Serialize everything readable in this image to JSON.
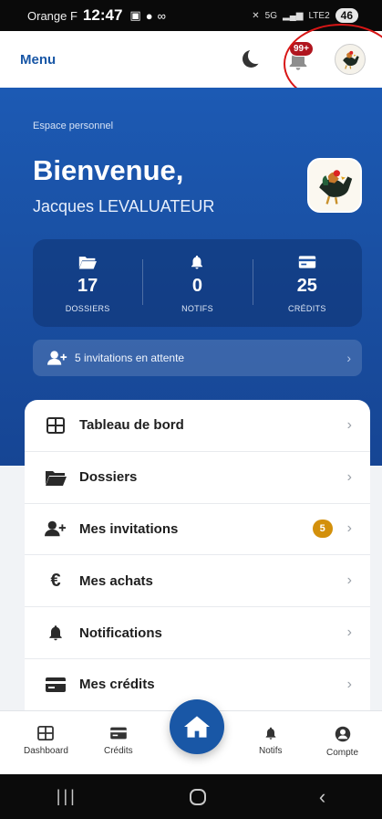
{
  "status_bar": {
    "carrier": "Orange F",
    "time": "12:47",
    "network": "5G",
    "lte": "LTE2",
    "battery": "46"
  },
  "appbar": {
    "menu_label": "Menu",
    "notif_badge": "99+"
  },
  "hero": {
    "space_label": "Espace personnel",
    "welcome": "Bienvenue,",
    "user_name": "Jacques LEVALUATEUR",
    "stats": [
      {
        "icon": "folder-icon",
        "value": "17",
        "label": "DOSSIERS"
      },
      {
        "icon": "bell-icon",
        "value": "0",
        "label": "NOTIFS"
      },
      {
        "icon": "credit-card-icon",
        "value": "25",
        "label": "CRÉDITS"
      }
    ],
    "invitations_text": "5 invitations en attente"
  },
  "menu": {
    "items": [
      {
        "icon": "grid-icon",
        "label": "Tableau de bord"
      },
      {
        "icon": "folder-icon",
        "label": "Dossiers"
      },
      {
        "icon": "user-plus-icon",
        "label": "Mes invitations",
        "badge": "5"
      },
      {
        "icon": "euro-icon",
        "label": "Mes achats"
      },
      {
        "icon": "bell-icon",
        "label": "Notifications"
      },
      {
        "icon": "credit-card-icon",
        "label": "Mes crédits"
      }
    ]
  },
  "bottom_nav": {
    "items": [
      {
        "icon": "grid-icon",
        "label": "Dashboard"
      },
      {
        "icon": "credit-card-icon",
        "label": "Crédits"
      },
      {
        "icon": "home-icon",
        "label": ""
      },
      {
        "icon": "bell-icon",
        "label": "Notifs"
      },
      {
        "icon": "account-icon",
        "label": "Compte"
      }
    ]
  },
  "colors": {
    "brand_blue": "#1957a6",
    "badge_red": "#b0151f",
    "badge_orange": "#d3900b",
    "annotation_red": "#d81616"
  }
}
